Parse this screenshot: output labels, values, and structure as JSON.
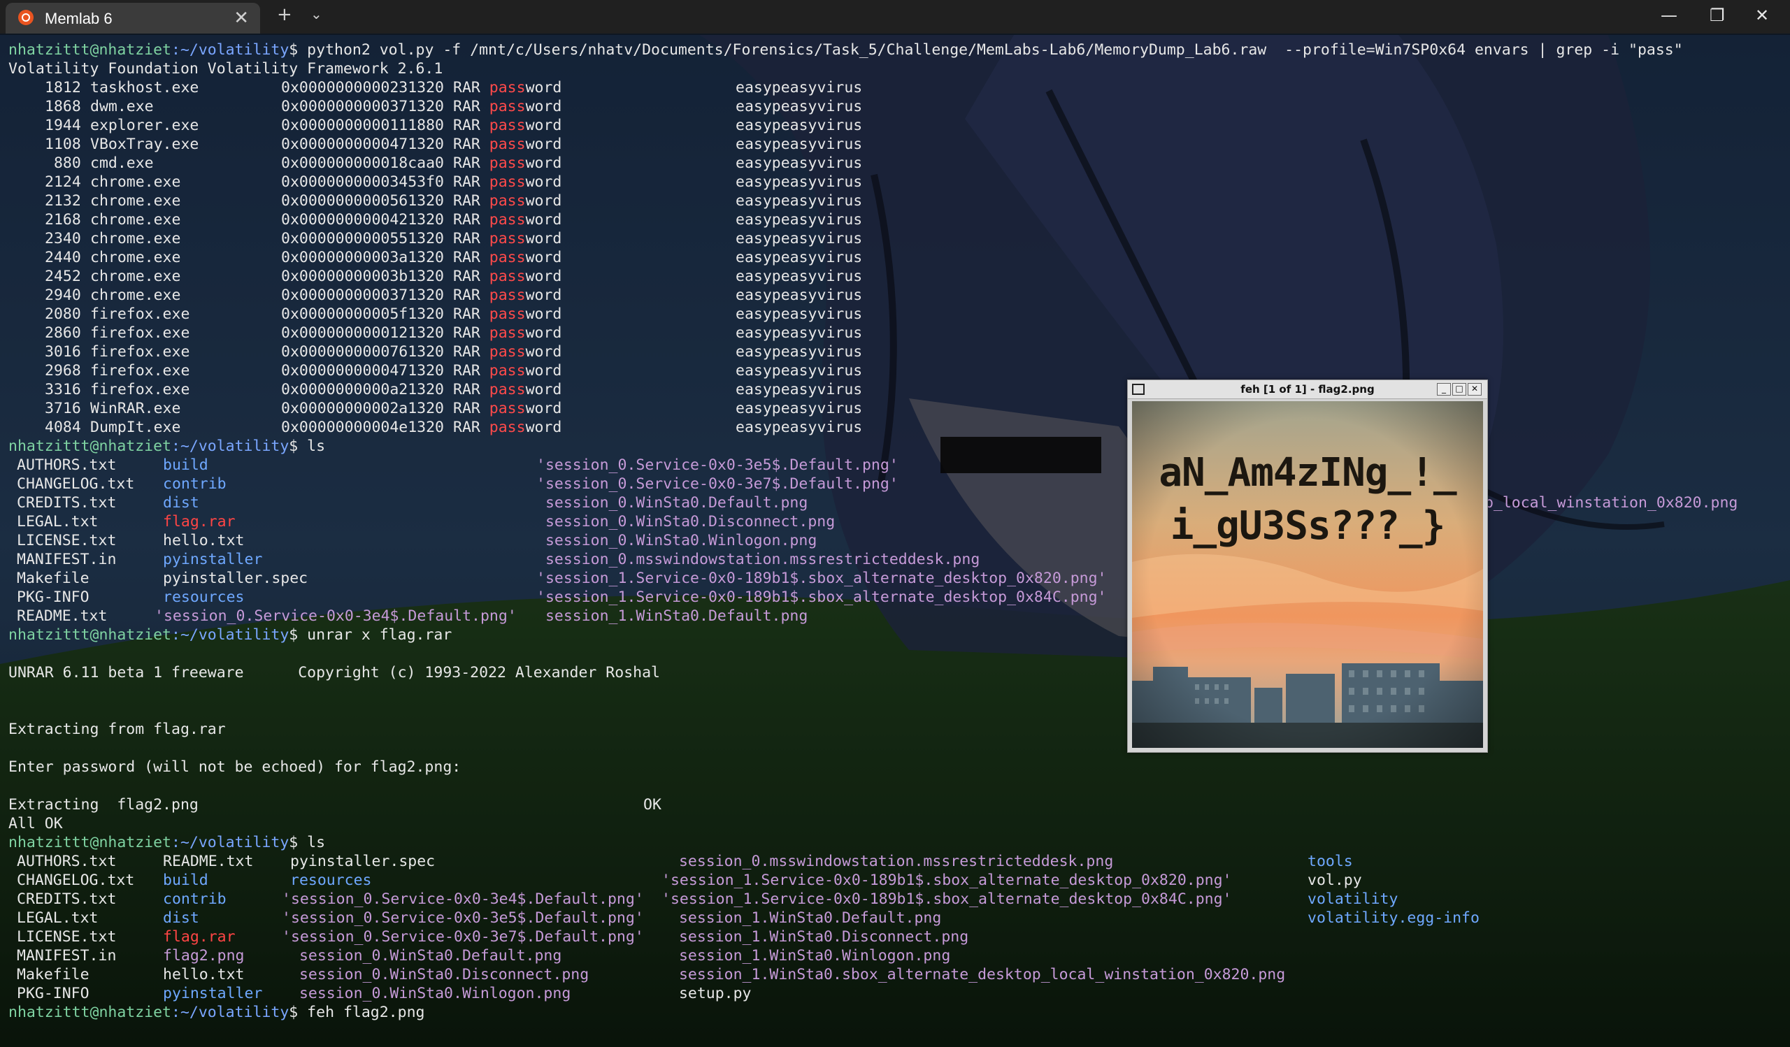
{
  "tab": {
    "title": "Memlab 6",
    "close": "✕",
    "new": "+",
    "dropdown": "⌄"
  },
  "window_controls": {
    "minimize": "—",
    "maximize": "❐",
    "close": "✕"
  },
  "prompt": {
    "user": "nhatzittt@nhatziet",
    "path": ":~/volatility",
    "sign": "$"
  },
  "commands": {
    "envars": " python2 vol.py -f /mnt/c/Users/nhatv/Documents/Forensics/Task_5/Challenge/MemLabs-Lab6/MemoryDump_Lab6.raw  --profile=Win7SP0x64 envars | grep -i \"pass\"",
    "ls": " ls",
    "unrar": " unrar x flag.rar",
    "feh": " feh flag2.png"
  },
  "volatility_banner": "Volatility Foundation Volatility Framework 2.6.1",
  "envars": {
    "var_pre": "RAR ",
    "var_hl": "pass",
    "var_post": "word",
    "value": "easypeasyvirus",
    "rows": [
      {
        "pid": "1812",
        "proc": "taskhost.exe",
        "addr": "0x0000000000231320"
      },
      {
        "pid": "1868",
        "proc": "dwm.exe",
        "addr": "0x0000000000371320"
      },
      {
        "pid": "1944",
        "proc": "explorer.exe",
        "addr": "0x0000000000111880"
      },
      {
        "pid": "1108",
        "proc": "VBoxTray.exe",
        "addr": "0x0000000000471320"
      },
      {
        "pid": " 880",
        "proc": "cmd.exe",
        "addr": "0x000000000018caa0"
      },
      {
        "pid": "2124",
        "proc": "chrome.exe",
        "addr": "0x00000000003453f0"
      },
      {
        "pid": "2132",
        "proc": "chrome.exe",
        "addr": "0x0000000000561320"
      },
      {
        "pid": "2168",
        "proc": "chrome.exe",
        "addr": "0x0000000000421320"
      },
      {
        "pid": "2340",
        "proc": "chrome.exe",
        "addr": "0x0000000000551320"
      },
      {
        "pid": "2440",
        "proc": "chrome.exe",
        "addr": "0x00000000003a1320"
      },
      {
        "pid": "2452",
        "proc": "chrome.exe",
        "addr": "0x00000000003b1320"
      },
      {
        "pid": "2940",
        "proc": "chrome.exe",
        "addr": "0x0000000000371320"
      },
      {
        "pid": "2080",
        "proc": "firefox.exe",
        "addr": "0x00000000005f1320"
      },
      {
        "pid": "2860",
        "proc": "firefox.exe",
        "addr": "0x0000000000121320"
      },
      {
        "pid": "3016",
        "proc": "firefox.exe",
        "addr": "0x0000000000761320"
      },
      {
        "pid": "2968",
        "proc": "firefox.exe",
        "addr": "0x0000000000471320"
      },
      {
        "pid": "3316",
        "proc": "firefox.exe",
        "addr": "0x0000000000a21320"
      },
      {
        "pid": "3716",
        "proc": "WinRAR.exe",
        "addr": "0x00000000002a1320"
      },
      {
        "pid": "4084",
        "proc": "DumpIt.exe",
        "addr": "0x00000000004e1320"
      }
    ]
  },
  "ls1": {
    "col1": [
      "AUTHORS.txt",
      "CHANGELOG.txt",
      "CREDITS.txt",
      "LEGAL.txt",
      "LICENSE.txt",
      "MANIFEST.in",
      "Makefile",
      "PKG-INFO",
      "README.txt"
    ],
    "col2": [
      "build",
      "contrib",
      "dist",
      "flag.rar",
      "hello.txt",
      "pyinstaller",
      "pyinstaller.spec",
      "resources",
      "'session_0.Service-0x0-3e4$.Default.png'"
    ],
    "col3": [
      "'session_0.Service-0x0-3e5$.Default.png'",
      "'session_0.Service-0x0-3e7$.Default.png'",
      " session_0.WinSta0.Default.png",
      " session_0.WinSta0.Disconnect.png",
      " session_0.WinSta0.Winlogon.png",
      " session_0.msswindowstation.mssrestricteddesk.png",
      "'session_1.Service-0x0-189b1$.sbox_alternate_desktop_0x820.png'",
      "'session_1.Service-0x0-189b1$.sbox_alternate_desktop_0x84C.png'",
      " session_1.WinSta0.Default.png"
    ],
    "partial": "op_local_winstation_0x820.png"
  },
  "unrar": {
    "banner": "UNRAR 6.11 beta 1 freeware      Copyright (c) 1993-2022 Alexander Roshal",
    "extracting_from": "Extracting from flag.rar",
    "password_prompt": "Enter password (will not be echoed) for flag2.png:",
    "extracting": "Extracting  flag2.png",
    "ok": "OK",
    "all_ok": "All OK"
  },
  "ls2": {
    "col1": [
      "AUTHORS.txt",
      "CHANGELOG.txt",
      "CREDITS.txt",
      "LEGAL.txt",
      "LICENSE.txt",
      "MANIFEST.in",
      "Makefile",
      "PKG-INFO"
    ],
    "col2": [
      "README.txt",
      "build",
      "contrib",
      "dist",
      "flag.rar",
      "flag2.png",
      "hello.txt",
      "pyinstaller"
    ],
    "col3": [
      "pyinstaller.spec",
      "resources",
      "'session_0.Service-0x0-3e4$.Default.png'",
      "'session_0.Service-0x0-3e5$.Default.png'",
      "'session_0.Service-0x0-3e7$.Default.png'",
      " session_0.WinSta0.Default.png",
      " session_0.WinSta0.Disconnect.png",
      " session_0.WinSta0.Winlogon.png"
    ],
    "col4": [
      " session_0.msswindowstation.mssrestricteddesk.png",
      "'session_1.Service-0x0-189b1$.sbox_alternate_desktop_0x820.png'",
      "'session_1.Service-0x0-189b1$.sbox_alternate_desktop_0x84C.png'",
      " session_1.WinSta0.Default.png",
      " session_1.WinSta0.Disconnect.png",
      " session_1.WinSta0.Winlogon.png",
      " session_1.WinSta0.sbox_alternate_desktop_local_winstation_0x820.png",
      " setup.py"
    ],
    "col5": [
      "tools",
      "vol.py",
      "volatility",
      "volatility.egg-info"
    ]
  },
  "feh": {
    "title": "feh [1 of 1] - flag2.png",
    "btn_min": "_",
    "btn_max": "□",
    "btn_close": "✕",
    "flag_line1": "aN_Am4zINg_!_",
    "flag_line2": "i_gU3Ss???_}"
  }
}
